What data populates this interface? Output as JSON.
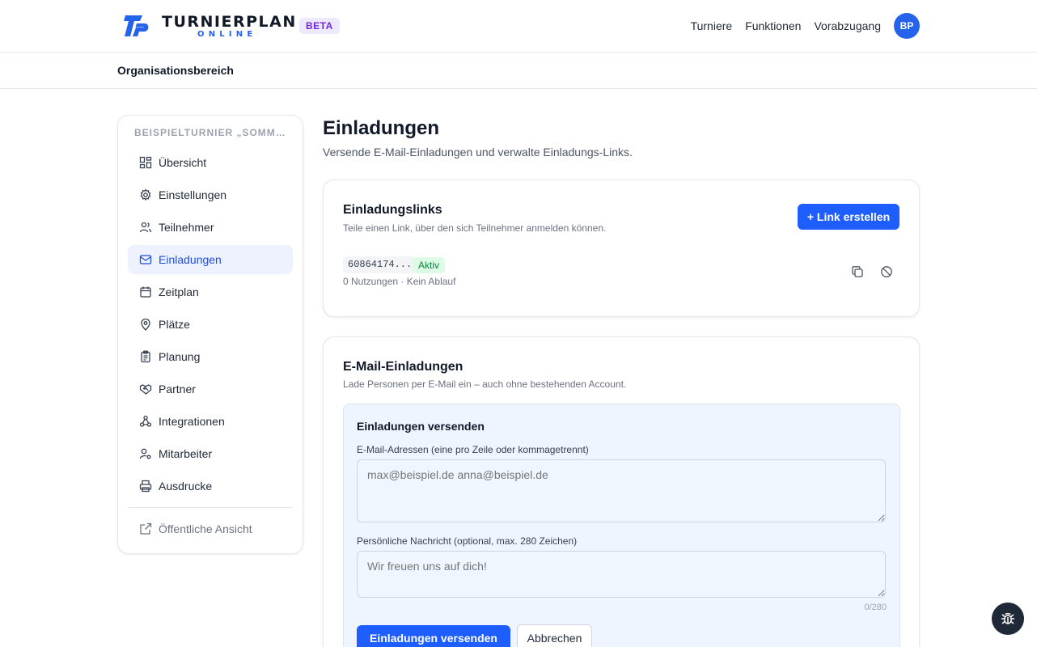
{
  "brand": {
    "name": "TURNIERPLAN",
    "sub": "ONLINE",
    "badge": "BETA"
  },
  "nav": {
    "items": [
      "Turniere",
      "Funktionen",
      "Vorabzugang"
    ],
    "avatar": "BP"
  },
  "subnav": {
    "title": "Organisationsbereich"
  },
  "sidebar": {
    "heading": "BEISPIELTURNIER „SOMME...",
    "items": [
      {
        "label": "Übersicht",
        "icon": "grid-icon"
      },
      {
        "label": "Einstellungen",
        "icon": "gear-icon"
      },
      {
        "label": "Teilnehmer",
        "icon": "users-icon"
      },
      {
        "label": "Einladungen",
        "icon": "mail-icon",
        "active": true
      },
      {
        "label": "Zeitplan",
        "icon": "calendar-icon"
      },
      {
        "label": "Plätze",
        "icon": "map-pin-icon"
      },
      {
        "label": "Planung",
        "icon": "clipboard-icon"
      },
      {
        "label": "Partner",
        "icon": "handshake-icon"
      },
      {
        "label": "Integrationen",
        "icon": "webhook-icon"
      },
      {
        "label": "Mitarbeiter",
        "icon": "user-cog-icon"
      },
      {
        "label": "Ausdrucke",
        "icon": "printer-icon"
      }
    ],
    "public_view": {
      "label": "Öffentliche Ansicht",
      "icon": "external-link-icon"
    }
  },
  "page": {
    "title": "Einladungen",
    "subtitle": "Versende E-Mail-Einladungen und verwalte Einladungs-Links."
  },
  "links_card": {
    "title": "Einladungslinks",
    "subtitle": "Teile einen Link, über den sich Teilnehmer anmelden können.",
    "create_label": "+ Link erstellen",
    "link": {
      "code": "60864174...",
      "status": "Aktiv",
      "meta": "0 Nutzungen · Kein Ablauf"
    }
  },
  "email_card": {
    "title": "E-Mail-Einladungen",
    "subtitle": "Lade Personen per E-Mail ein – auch ohne bestehenden Account.",
    "form": {
      "title": "Einladungen versenden",
      "emails_label": "E-Mail-Adressen (eine pro Zeile oder kommagetrennt)",
      "emails_placeholder": "max@beispiel.de anna@beispiel.de",
      "message_label": "Persönliche Nachricht (optional, max. 280 Zeichen)",
      "message_placeholder": "Wir freuen uns auf dich!",
      "counter": "0/280",
      "send_label": "Einladungen versenden",
      "cancel_label": "Abbrechen"
    }
  },
  "colors": {
    "accent": "#1e5eff",
    "active_bg": "#eef2ff",
    "badge_bg": "#ede9fe",
    "success": "#15803d"
  },
  "fab": {
    "icon": "bug-icon"
  }
}
